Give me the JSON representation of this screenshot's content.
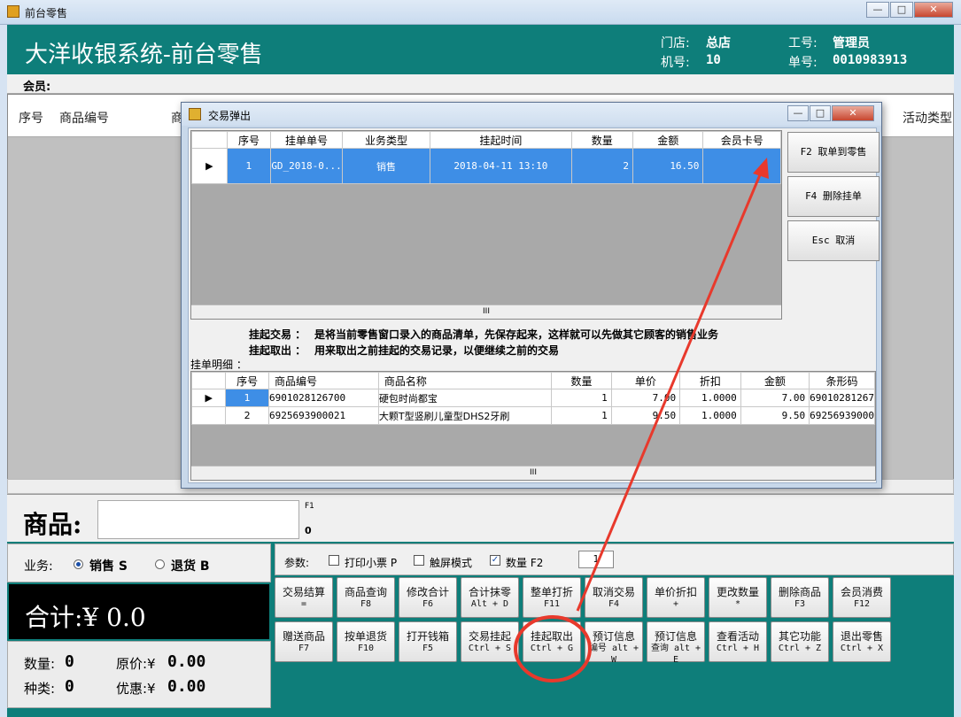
{
  "window": {
    "title": "前台零售",
    "min": "▭",
    "max": "□",
    "close": "✕"
  },
  "header": {
    "brand": "大洋收银系统-前台零售",
    "store_label": "门店:",
    "store": "总店",
    "machine_label": "机号:",
    "machine": "10",
    "staff_label": "工号:",
    "staff": "管理员",
    "order_label": "单号:",
    "order": "0010983913"
  },
  "member_label": "会员:",
  "main_columns": [
    "序号",
    "商品编号",
    "商",
    "活动类型"
  ],
  "goods": {
    "label": "商品:",
    "f1": "F1",
    "zero": "0"
  },
  "business": {
    "label": "业务:",
    "sale": "销售 S",
    "refund": "退货 B"
  },
  "total": {
    "text": "合计:¥ 0.0"
  },
  "stats": {
    "qty_label": "数量:",
    "qty": "0",
    "orig_label": "原价:¥",
    "orig": "0.00",
    "kinds_label": "种类:",
    "kinds": "0",
    "disc_label": "优惠:¥",
    "disc": "0.00"
  },
  "params": {
    "label": "参数:",
    "print": "打印小票 P",
    "touch": "触屏模式",
    "qty": "数量 F2",
    "qty_value": "1"
  },
  "buttons": [
    [
      "交易结算",
      "="
    ],
    [
      "商品查询",
      "F8"
    ],
    [
      "修改合计",
      "F6"
    ],
    [
      "合计抹零",
      "Alt + D"
    ],
    [
      "整单打折",
      "F11"
    ],
    [
      "取消交易",
      "F4"
    ],
    [
      "单价折扣",
      "+"
    ],
    [
      "更改数量",
      "*"
    ],
    [
      "删除商品",
      "F3"
    ],
    [
      "会员消费",
      "F12"
    ],
    [
      "赠送商品",
      "F7"
    ],
    [
      "按单退货",
      "F10"
    ],
    [
      "打开钱箱",
      "F5"
    ],
    [
      "交易挂起",
      "Ctrl + S"
    ],
    [
      "挂起取出",
      "Ctrl + G"
    ],
    [
      "预订信息",
      "编号 alt + W"
    ],
    [
      "预订信息",
      "查询 alt + E"
    ],
    [
      "查看活动",
      "Ctrl + H"
    ],
    [
      "其它功能",
      "Ctrl + Z"
    ],
    [
      "退出零售",
      "Ctrl + X"
    ]
  ],
  "dialog": {
    "title": "交易弹出",
    "hold_columns": [
      "序号",
      "挂单单号",
      "业务类型",
      "挂起时间",
      "数量",
      "金额",
      "会员卡号"
    ],
    "hold_rows": [
      {
        "no": "1",
        "id": "GD_2018-0...",
        "type": "销售",
        "time": "2018-04-11 13:10",
        "qty": "2",
        "amount": "16.50",
        "card": ""
      }
    ],
    "side_buttons": [
      "F2 取单到零售",
      "F4 删除挂单",
      "Esc 取消"
    ],
    "note1_key": "挂起交易 ：",
    "note1": "是将当前零售窗口录入的商品清单，先保存起来，这样就可以先做其它顾客的销售业务",
    "note2_key": "挂起取出 ：",
    "note2": "用来取出之前挂起的交易记录，以便继续之前的交易",
    "detail_label": "挂单明细 ：",
    "detail_columns": [
      "序号",
      "商品编号",
      "商品名称",
      "数量",
      "单价",
      "折扣",
      "金额",
      "条形码"
    ],
    "detail_rows": [
      {
        "no": "1",
        "code": "6901028126700",
        "name": "硬包时尚都宝",
        "qty": "1",
        "price": "7.00",
        "disc": "1.0000",
        "amount": "7.00",
        "bar": "69010281267"
      },
      {
        "no": "2",
        "code": "6925693900021",
        "name": "大颗T型竖刷儿童型DHS2牙刷",
        "qty": "1",
        "price": "9.50",
        "disc": "1.0000",
        "amount": "9.50",
        "bar": "69256939000"
      }
    ],
    "scroll_mark": "III"
  },
  "colors": {
    "teal": "#0e7e7a",
    "select": "#3e8ee6",
    "annotation": "#e8392c"
  }
}
